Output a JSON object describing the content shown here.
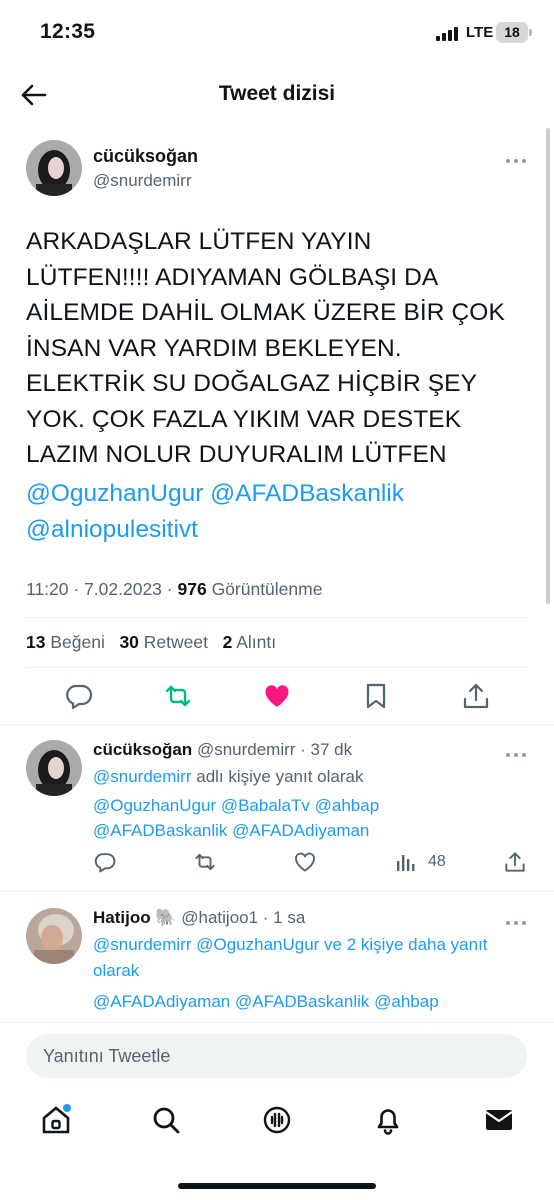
{
  "status_bar": {
    "time": "12:35",
    "network": "LTE",
    "battery": "18"
  },
  "header": {
    "title": "Tweet dizisi"
  },
  "main_tweet": {
    "name": "cücüksoğan",
    "handle": "@snurdemirr",
    "text_lines": [
      "ARKADAŞLAR LÜTFEN YAYIN",
      "LÜTFEN!!!! ADIYAMAN GÖLBAŞI DA",
      "AİLEMDE DAHİL OLMAK ÜZERE BİR ÇOK",
      "İNSAN VAR YARDIM BEKLEYEN.",
      "ELEKTRİK SU DOĞALGAZ HİÇBİR ŞEY",
      "YOK. ÇOK FAZLA YIKIM VAR DESTEK",
      "LAZIM NOLUR DUYURALIM LÜTFEN"
    ],
    "mentions": [
      "@OguzhanUgur",
      "@AFADBaskanlik",
      "@alniopulesitivt"
    ],
    "time": "11:20",
    "date": "7.02.2023",
    "views": "976",
    "views_label": "Görüntülenme",
    "likes": "13",
    "likes_label": "Beğeni",
    "retweets": "30",
    "retweets_label": "Retweet",
    "quotes": "2",
    "quotes_label": "Alıntı"
  },
  "replies": [
    {
      "name": "cücüksoğan",
      "handle": "@snurdemirr",
      "age": "37 dk",
      "reply_to_mention": "@snurdemirr",
      "reply_to_text": "adlı kişiye yanıt olarak",
      "mention_lines": [
        "@OguzhanUgur @BabalaTv @ahbap",
        "@AFADBaskanlik @AFADAdiyaman"
      ],
      "views": "48"
    },
    {
      "name": "Hatijoo",
      "name_emoji": "🐘",
      "handle": "@hatijoo1",
      "age": "1 sa",
      "reply_to_line1": "@snurdemirr @OguzhanUgur ve 2 kişiye daha yanıt",
      "reply_to_line2": "olarak",
      "mention_line": "@AFADAdiyaman @AFADBaskanlik @ahbap"
    }
  ],
  "compose": {
    "placeholder": "Yanıtını Tweetle"
  },
  "tab_bar": {
    "items": [
      "home-icon",
      "search-icon",
      "spaces-icon",
      "notifications-icon",
      "messages-icon"
    ]
  },
  "colors": {
    "accent": "#1d9bf0",
    "like": "#f91880",
    "retweet": "#00ba7c",
    "text": "#0f1419",
    "secondary": "#536471"
  }
}
